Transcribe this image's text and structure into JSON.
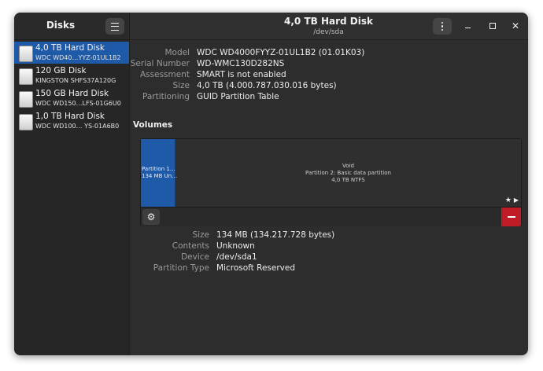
{
  "app": {
    "title": "Disks",
    "window_title": "4,0 TB Hard Disk",
    "window_subtitle": "/dev/sda"
  },
  "icons": {
    "menu": "hamburger-icon",
    "options": "kebab-icon",
    "minimize": "minimize-icon",
    "maximize": "maximize-icon",
    "close": "close-icon",
    "close_glyph": "✕",
    "gear_glyph": "⚙",
    "star_glyph": "★",
    "play_glyph": "▶"
  },
  "sidebar": {
    "items": [
      {
        "name": "4,0 TB Hard Disk",
        "sub": "WDC WD40…YYZ-01UL1B2",
        "selected": true
      },
      {
        "name": "120 GB Disk",
        "sub": "KINGSTON SHFS37A120G",
        "selected": false
      },
      {
        "name": "150 GB Hard Disk",
        "sub": "WDC WD150…LFS-01G6U0",
        "selected": false
      },
      {
        "name": "1,0 TB Hard Disk",
        "sub": "WDC WD100…  YS-01A6B0",
        "selected": false
      }
    ]
  },
  "disk_info": [
    {
      "key": "Model",
      "value": "WDC WD4000FYYZ-01UL1B2 (01.01K03)"
    },
    {
      "key": "Serial Number",
      "value": "WD-WMC130D282NS"
    },
    {
      "key": "Assessment",
      "value": "SMART is not enabled"
    },
    {
      "key": "Size",
      "value": "4,0 TB (4.000.787.030.016 bytes)"
    },
    {
      "key": "Partitioning",
      "value": "GUID Partition Table"
    }
  ],
  "volumes": {
    "title": "Volumes",
    "partition1": {
      "line1": "Partition 1…",
      "line2": "134 MB Un…"
    },
    "void": {
      "line1": "Void",
      "line2": "Partition 2: Basic data partition",
      "line3": "4,0 TB NTFS"
    }
  },
  "partition_info": [
    {
      "key": "Size",
      "value": "134 MB (134.217.728 bytes)"
    },
    {
      "key": "Contents",
      "value": "Unknown"
    },
    {
      "key": "Device",
      "value": "/dev/sda1"
    },
    {
      "key": "Partition Type",
      "value": "Microsoft Reserved"
    }
  ],
  "colors": {
    "accent": "#1e5aa8",
    "destructive": "#c01c28",
    "window_bg": "#2d2d2d"
  }
}
